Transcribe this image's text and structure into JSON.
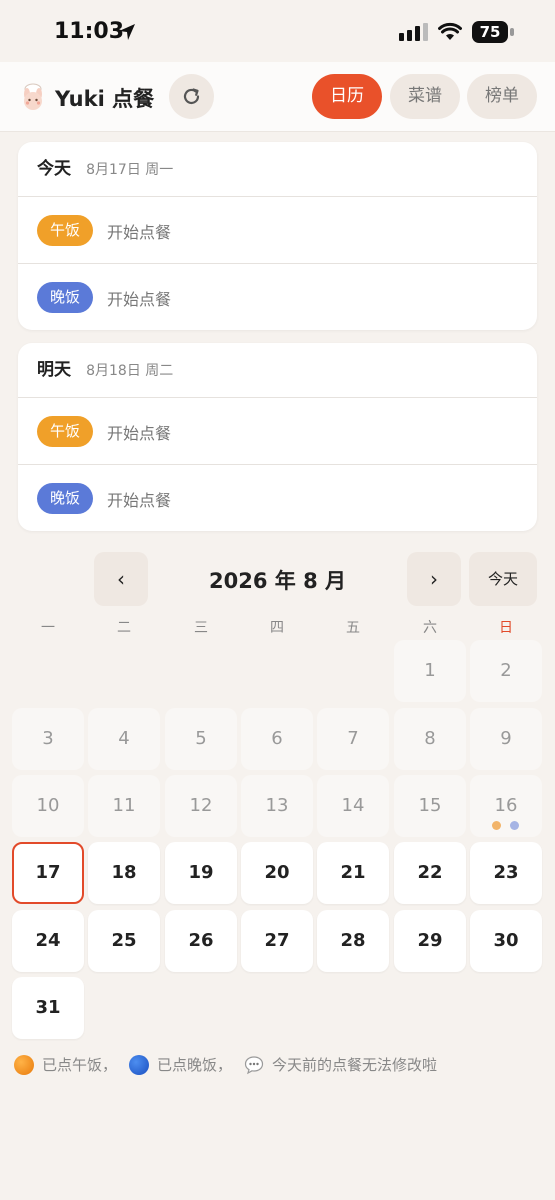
{
  "status_bar": {
    "time": "11:03",
    "battery": "75"
  },
  "header": {
    "title": "Yuki 点餐",
    "tabs": [
      {
        "label": "日历",
        "active": true
      },
      {
        "label": "菜谱",
        "active": false
      },
      {
        "label": "榜单",
        "active": false
      }
    ]
  },
  "days": [
    {
      "day": "今天",
      "date": "8月17日 周一",
      "meals": [
        {
          "badge": "午饭",
          "action": "开始点餐"
        },
        {
          "badge": "晚饭",
          "action": "开始点餐"
        }
      ]
    },
    {
      "day": "明天",
      "date": "8月18日 周二",
      "meals": [
        {
          "badge": "午饭",
          "action": "开始点餐"
        },
        {
          "badge": "晚饭",
          "action": "开始点餐"
        }
      ]
    }
  ],
  "calendar": {
    "prev": "‹",
    "next": "›",
    "title": "2026 年 8 月",
    "today_label": "今天",
    "weekdays": [
      "一",
      "二",
      "三",
      "四",
      "五",
      "六",
      "日"
    ],
    "today_date": 17,
    "dates_with_orders": [
      16
    ],
    "days": [
      "1",
      "2",
      "3",
      "4",
      "5",
      "6",
      "7",
      "8",
      "9",
      "10",
      "11",
      "12",
      "13",
      "14",
      "15",
      "16",
      "17",
      "18",
      "19",
      "20",
      "21",
      "22",
      "23",
      "24",
      "25",
      "26",
      "27",
      "28",
      "29",
      "30",
      "31"
    ]
  },
  "legend": {
    "lunch": "已点午饭，",
    "dinner": "已点晚饭，",
    "note": "今天前的点餐无法修改啦"
  },
  "colors": {
    "accent": "#e9512a",
    "lunch": "#f0a029",
    "dinner": "#5b7ad8",
    "background": "#f6f2ee"
  }
}
